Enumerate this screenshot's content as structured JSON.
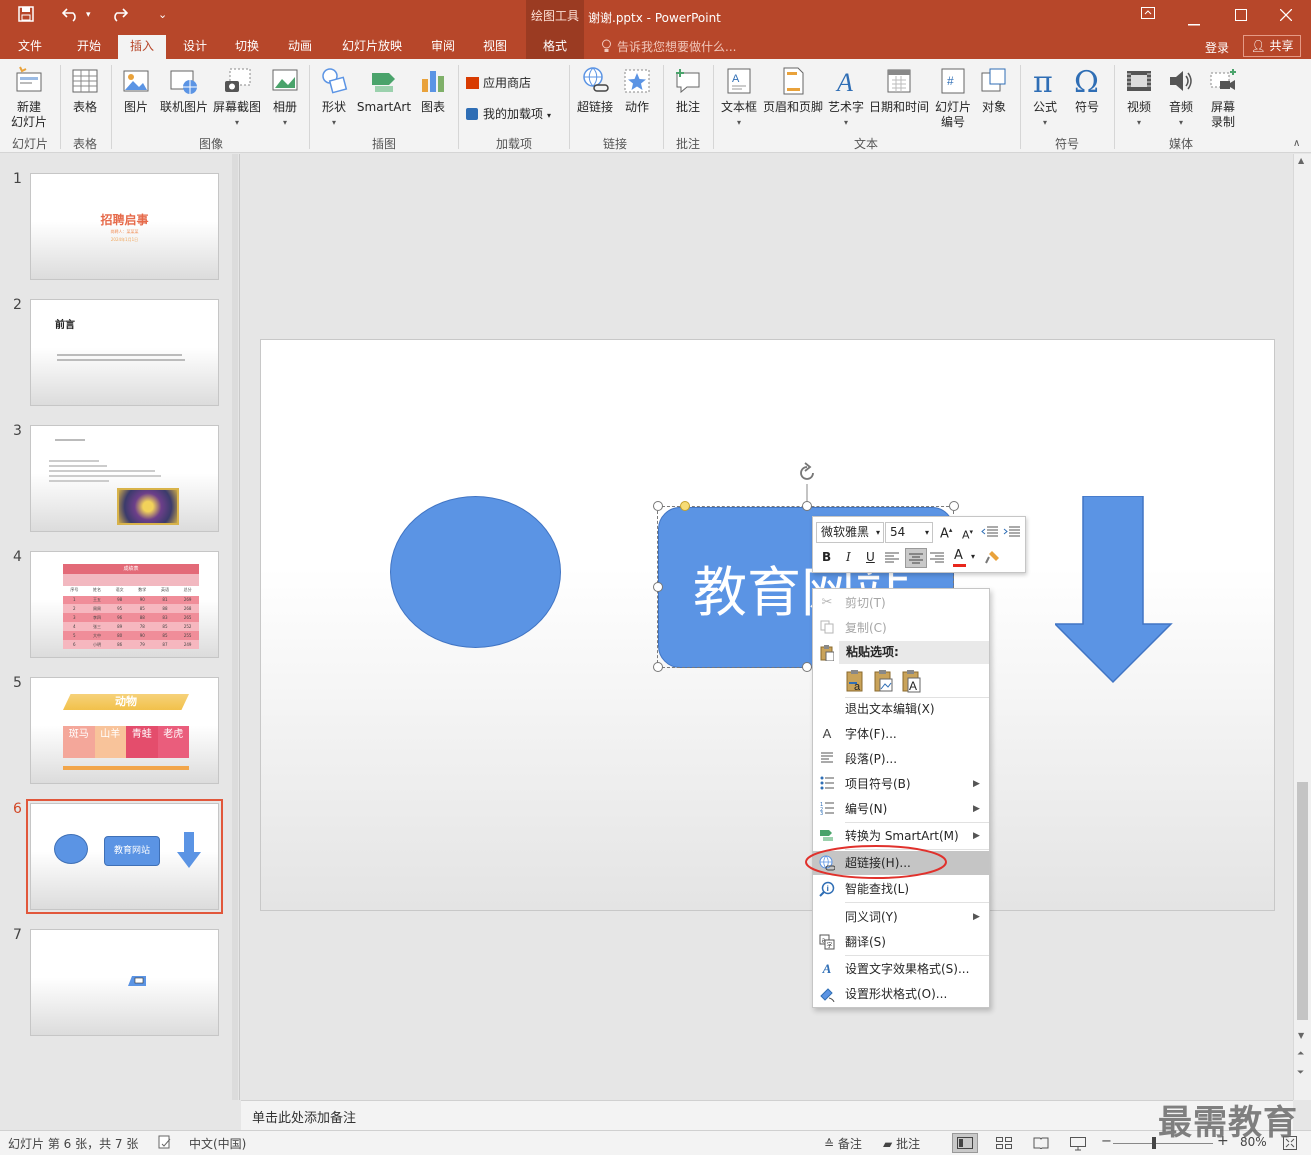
{
  "titlebar": {
    "context_tools": "绘图工具",
    "doc_title": "谢谢.pptx - PowerPoint",
    "qa_icons": [
      "save-icon",
      "undo-icon",
      "redo-icon",
      "customize-icon"
    ]
  },
  "tabs": [
    "文件",
    "开始",
    "插入",
    "设计",
    "切换",
    "动画",
    "幻灯片放映",
    "审阅",
    "视图",
    "格式"
  ],
  "active_tab": "插入",
  "tellme": "告诉我您想要做什么...",
  "login": "登录",
  "share": "共享",
  "ribbon": {
    "new_slide": "新建\n幻灯片",
    "table": "表格",
    "picture": "图片",
    "online_picture": "联机图片",
    "screenshot": "屏幕截图",
    "album": "相册",
    "shapes": "形状",
    "smartart": "SmartArt",
    "chart": "图表",
    "store": "应用商店",
    "my_addins": "我的加载项",
    "hyperlink": "超链接",
    "action": "动作",
    "comment": "批注",
    "textbox": "文本框",
    "header_footer": "页眉和页脚",
    "wordart": "艺术字",
    "date_time": "日期和时间",
    "slide_number": "幻灯片\n编号",
    "object": "对象",
    "equation": "公式",
    "symbol": "符号",
    "video": "视频",
    "audio": "音频",
    "screen_recording": "屏幕\n录制",
    "groups": {
      "slides": "幻灯片",
      "tables": "表格",
      "images": "图像",
      "illustrations": "插图",
      "addins": "加载项",
      "links": "链接",
      "comments": "批注",
      "text": "文本",
      "symbols": "符号",
      "media": "媒体"
    }
  },
  "thumbnails": {
    "numbers": [
      "1",
      "2",
      "3",
      "4",
      "5",
      "6",
      "7"
    ],
    "s1_title": "招聘启事",
    "s1_sub": "岗聘人：某某某",
    "s1_date": "2024年1月1日",
    "s2_title": "前言",
    "s4_title": "成绩表",
    "s4_headers": [
      "序号",
      "姓名",
      "语文",
      "数学",
      "英语",
      "总分"
    ],
    "s4_rows": [
      [
        "1",
        "王五",
        "98",
        "90",
        "81",
        "269"
      ],
      [
        "2",
        "周周",
        "95",
        "85",
        "88",
        "268"
      ],
      [
        "3",
        "李四",
        "96",
        "88",
        "83",
        "265"
      ],
      [
        "4",
        "张三",
        "89",
        "78",
        "85",
        "252"
      ],
      [
        "5",
        "大中",
        "80",
        "90",
        "85",
        "255"
      ],
      [
        "6",
        "小明",
        "86",
        "79",
        "87",
        "249"
      ]
    ],
    "s5_title": "动物",
    "s5_cards": [
      "斑马",
      "山羊",
      "青蛙",
      "老虎"
    ],
    "s6_label": "教育网站"
  },
  "slide": {
    "textbox_text": "教育网站"
  },
  "minibar": {
    "font": "微软雅黑",
    "size": "54",
    "bold": "B",
    "italic": "I",
    "underline": "U",
    "font_color": "A"
  },
  "context_menu": {
    "cut": "剪切(T)",
    "copy": "复制(C)",
    "paste_options": "粘贴选项:",
    "exit_edit": "退出文本编辑(X)",
    "font": "字体(F)...",
    "paragraph": "段落(P)...",
    "bullets": "项目符号(B)",
    "numbering": "编号(N)",
    "smartart": "转换为 SmartArt(M)",
    "hyperlink": "超链接(H)...",
    "smart_lookup": "智能查找(L)",
    "synonyms": "同义词(Y)",
    "translate": "翻译(S)",
    "text_effects": "设置文字效果格式(S)...",
    "shape_format": "设置形状格式(O)..."
  },
  "notes": "单击此处添加备注",
  "status": {
    "slide_info": "幻灯片 第 6 张，共 7 张",
    "language": "中文(中国)",
    "notes_btn": "备注",
    "comments_btn": "批注",
    "zoom": "80%"
  },
  "watermark": "最需教育",
  "colors": {
    "accent": "#b7472a",
    "shape_fill": "#5b94e4",
    "selection": "#e1573b",
    "highlight_circle": "#e0312c"
  }
}
